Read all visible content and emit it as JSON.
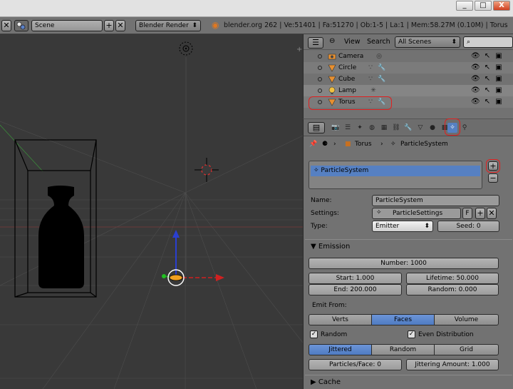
{
  "window": {
    "minimize": "_",
    "maximize": "□",
    "close": "X"
  },
  "infobar": {
    "scene_label": "Scene",
    "render_engine": "Blender Render",
    "stats": "blender.org 262 | Ve:51401 | Fa:51270 | Ob:1-5 | La:1 | Mem:58.27M (0.10M) | Torus"
  },
  "outliner": {
    "menu_view": "View",
    "menu_search": "Search",
    "scene_filter": "All Scenes",
    "items": [
      {
        "name": "Camera",
        "icon": "camera-icon"
      },
      {
        "name": "Circle",
        "icon": "mesh-icon"
      },
      {
        "name": "Cube",
        "icon": "mesh-icon"
      },
      {
        "name": "Lamp",
        "icon": "lamp-icon"
      },
      {
        "name": "Torus",
        "icon": "mesh-icon"
      }
    ]
  },
  "properties": {
    "breadcrumb": {
      "object": "Torus",
      "system": "ParticleSystem"
    },
    "list_item": "ParticleSystem",
    "name_label": "Name:",
    "name_value": "ParticleSystem",
    "settings_label": "Settings:",
    "settings_value": "ParticleSettings",
    "settings_fake": "F",
    "type_label": "Type:",
    "type_value": "Emitter",
    "seed": "Seed: 0",
    "emission": {
      "title": "Emission",
      "number": "Number: 1000",
      "start": "Start: 1.000",
      "end": "End: 200.000",
      "lifetime": "Lifetime: 50.000",
      "random": "Random: 0.000",
      "emit_from_label": "Emit From:",
      "emit_options": [
        "Verts",
        "Faces",
        "Volume"
      ],
      "random_check": "Random",
      "even_dist": "Even Distribution",
      "dist_options": [
        "Jittered",
        "Random",
        "Grid"
      ],
      "particles_face": "Particles/Face: 0",
      "jitter_amount": "Jittering Amount: 1.000"
    },
    "cache_title": "Cache"
  },
  "colors": {
    "accent": "#5680c2",
    "highlight_ring": "#e02020",
    "background": "#393939"
  }
}
